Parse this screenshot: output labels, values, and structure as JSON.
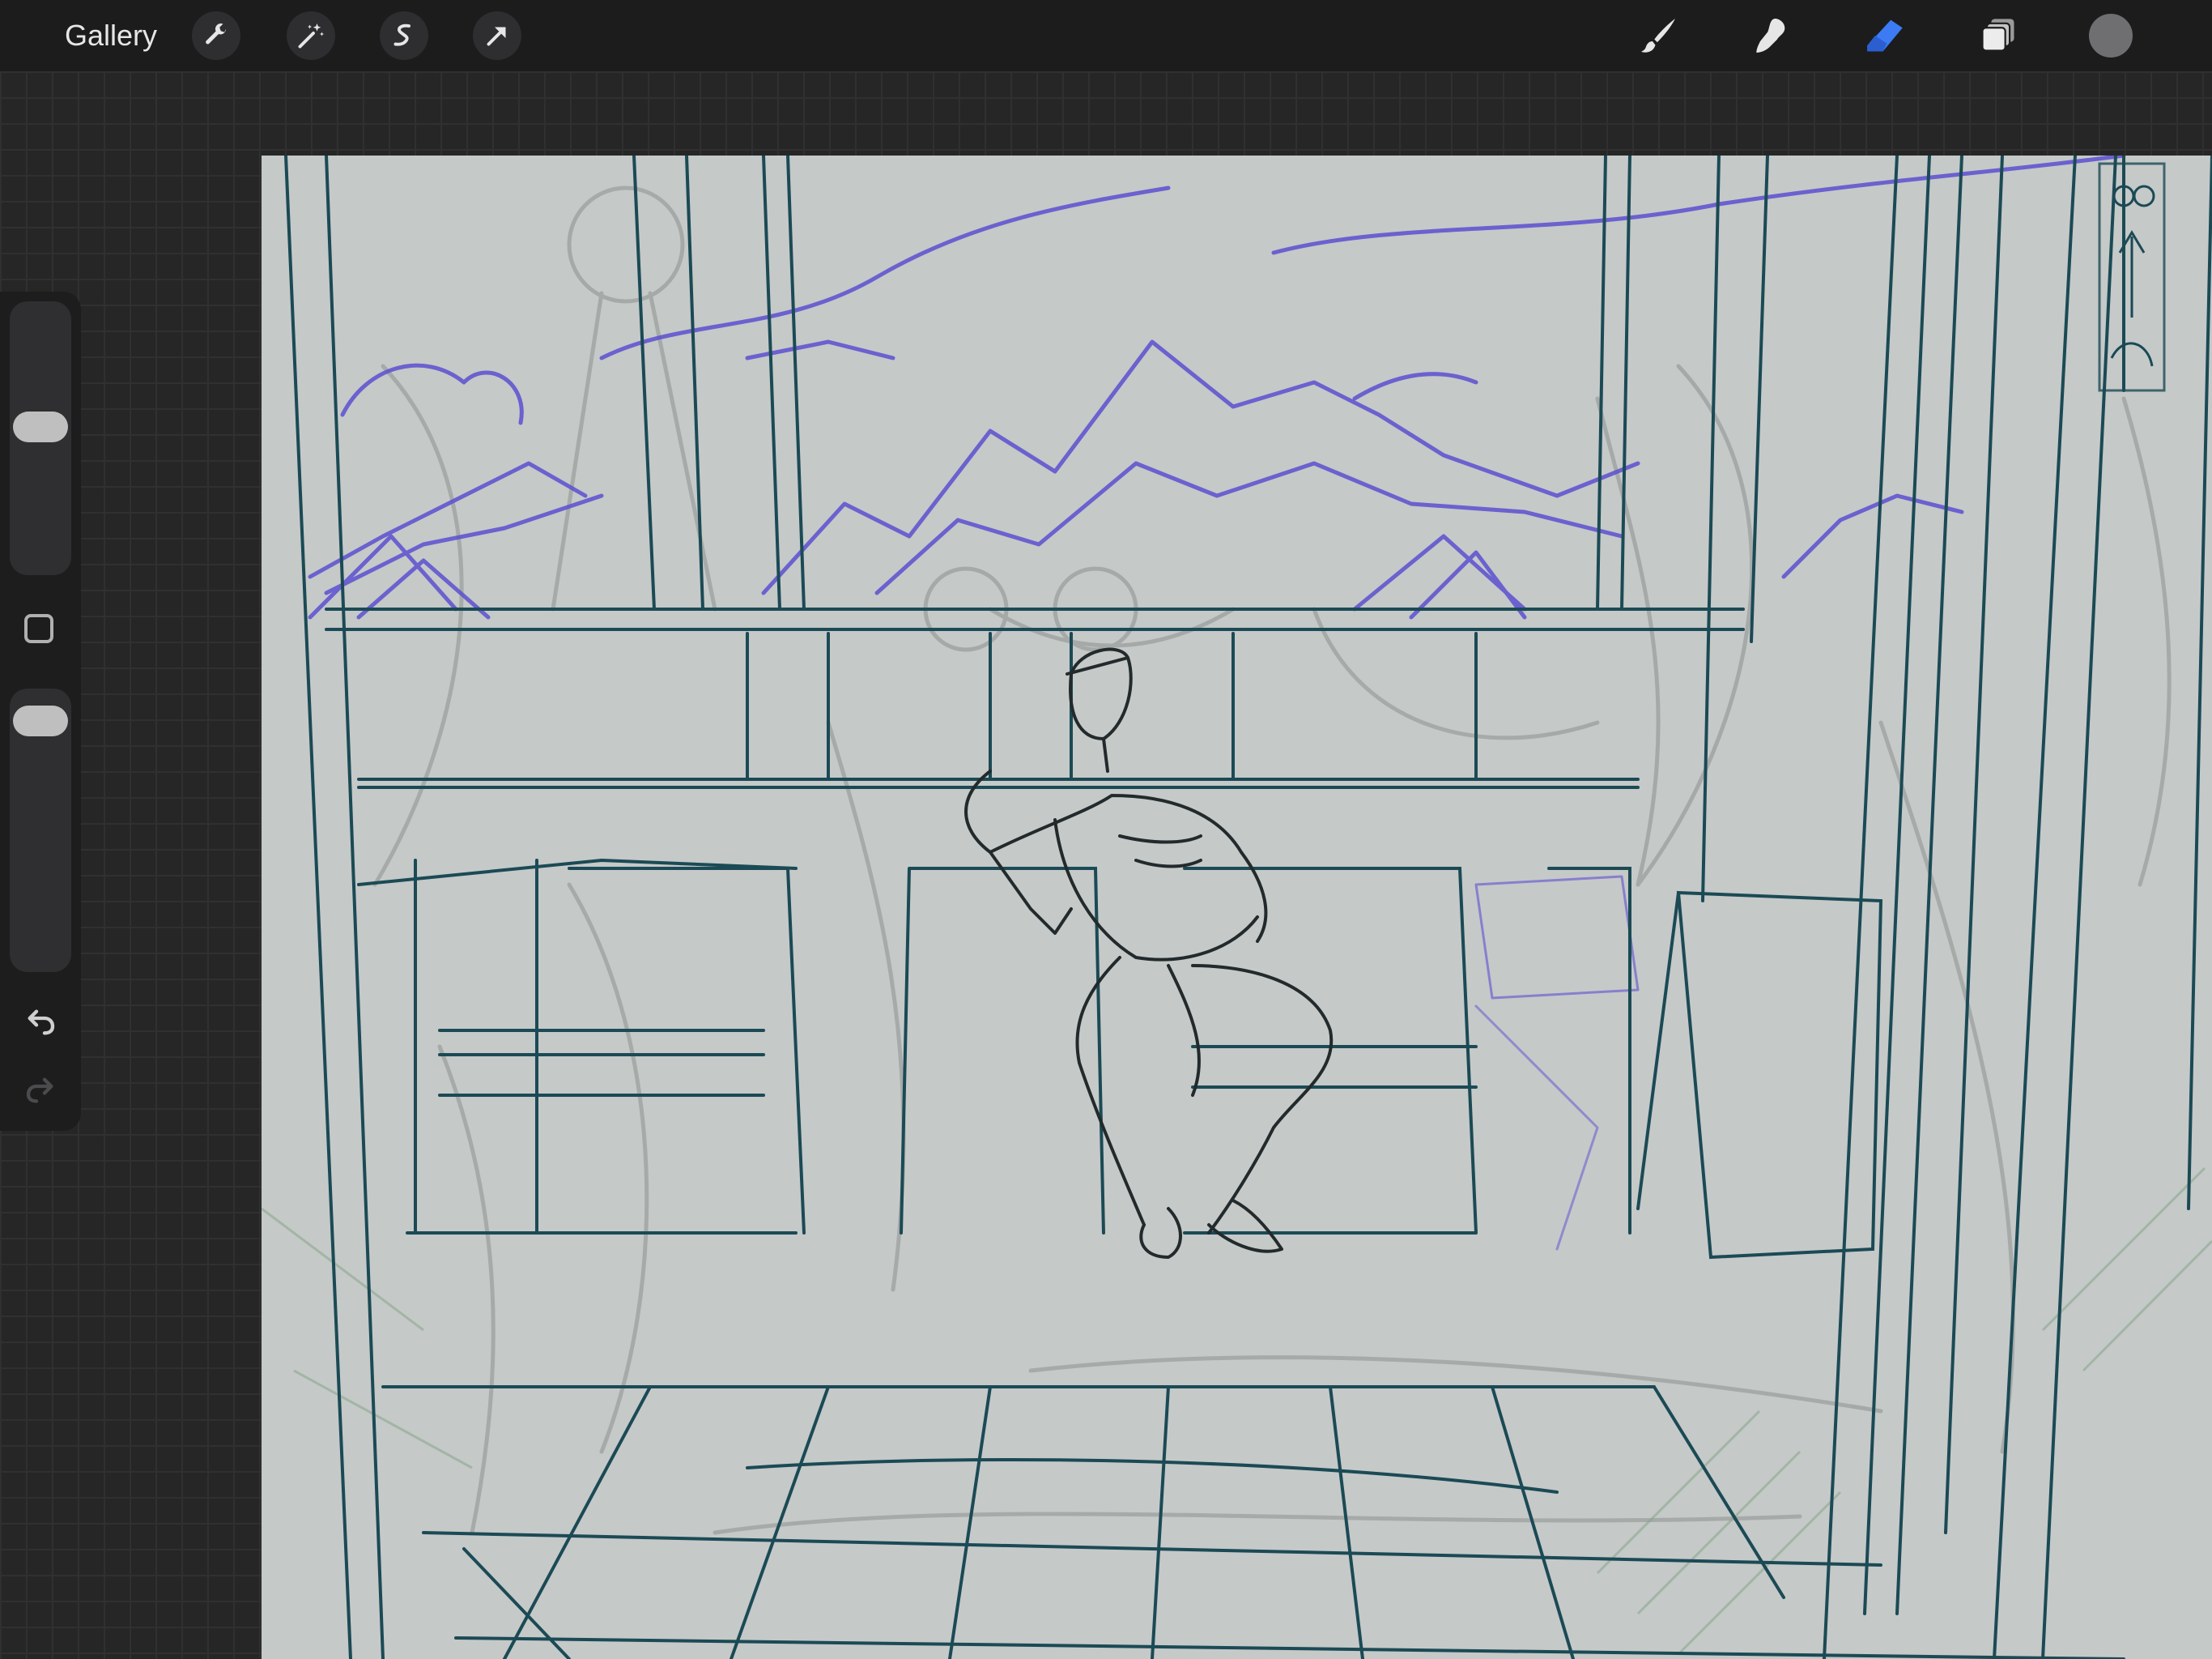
{
  "toolbar": {
    "gallery_label": "Gallery",
    "left_tools": [
      "actions-wrench-icon",
      "adjustments-magic-wand-icon",
      "selection-icon",
      "transform-arrow-icon"
    ],
    "right_tools": [
      "brush-icon",
      "smudge-icon",
      "eraser-icon",
      "layers-icon"
    ],
    "active_tool": "eraser",
    "active_color": "#6f6f72",
    "accent_color": "#3d7bf5"
  },
  "sidebar": {
    "brush_size_level": 0.55,
    "opacity_level": 0.95,
    "controls": [
      "brush-size-slider",
      "modify-button",
      "opacity-slider",
      "undo-icon",
      "redo-icon"
    ]
  },
  "canvas": {
    "background_color": "#c5c9c8",
    "ink_color": "#1b4a55",
    "sketch_color": "#5b4fd0",
    "rough_color": "#8a8f8e"
  }
}
